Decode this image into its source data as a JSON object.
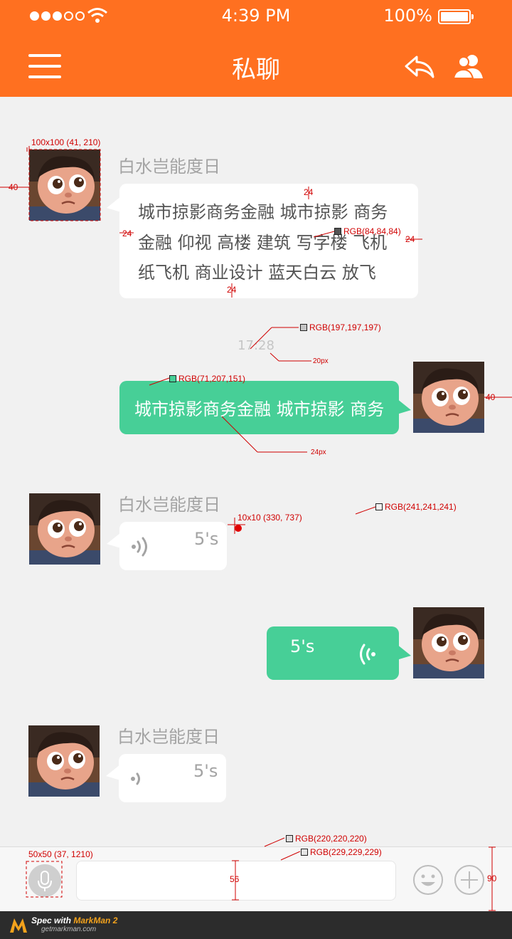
{
  "status_bar": {
    "time": "4:39 PM",
    "battery": "100%"
  },
  "nav": {
    "title": "私聊"
  },
  "timestamp": "17:28",
  "messages": [
    {
      "nick": "白水岂能度日",
      "lines": [
        "城市掠影商务金融 城市掠影 商务",
        "金融 仰视 高楼 建筑 写字楼 飞机",
        "纸飞机 商业设计 蓝天白云 放飞"
      ]
    },
    {
      "text": "城市掠影商务金融 城市掠影 商务"
    },
    {
      "nick": "白水岂能度日",
      "duration": "5's"
    },
    {
      "duration": "5's"
    },
    {
      "nick": "白水岂能度日",
      "duration": "5's"
    }
  ],
  "annotations": {
    "avatar_size": "100x100 (41, 210)",
    "avatar_margin_left": "40",
    "avatar_margin_right": "40",
    "padding_top": "24",
    "padding_bottom": "24",
    "padding_left": "24",
    "padding_right": "24",
    "text_color": "RGB(84,84,84)",
    "timestamp_color": "RGB(197,197,197)",
    "timestamp_size": "20px",
    "green_color": "RGB(71,207,151)",
    "green_text_size": "24px",
    "dot_size": "10x10 (330, 737)",
    "bg_color": "RGB(241,241,241)",
    "border_color": "RGB(220,220,220)",
    "bar_color": "RGB(229,229,229)",
    "voice_size": "50x50 (37, 1210)",
    "input_height": "56",
    "bar_height": "90"
  },
  "footer": {
    "text_prefix": "Spec with ",
    "brand": "MarkMan 2",
    "site": "getmarkman.com"
  },
  "colors": {
    "orange": "#ff7020",
    "green": "#47cf97",
    "background": "#f1f1f1",
    "text": "#545454"
  }
}
